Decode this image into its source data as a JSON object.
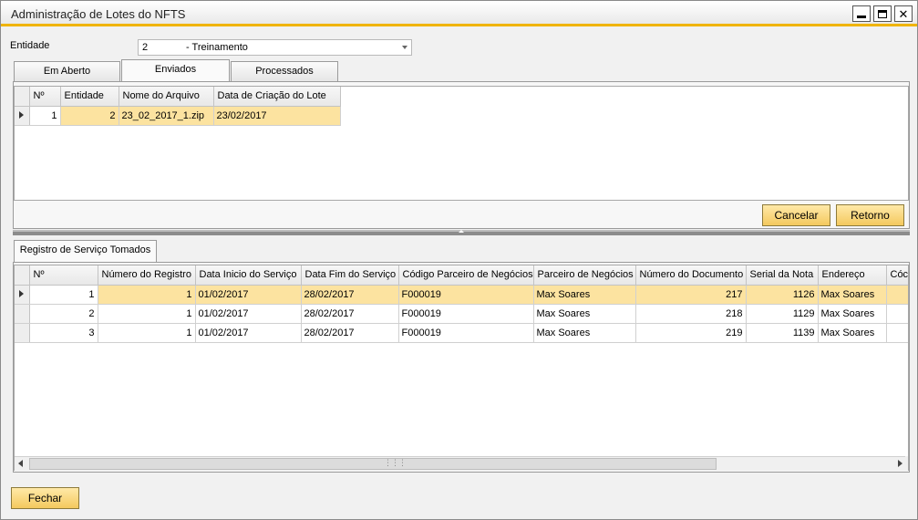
{
  "window": {
    "title": "Administração de Lotes do NFTS"
  },
  "entidade": {
    "label": "Entidade",
    "code": "2",
    "name": "- Treinamento"
  },
  "tabs": [
    {
      "label": "Em Aberto"
    },
    {
      "label": "Enviados"
    },
    {
      "label": "Processados"
    }
  ],
  "lotes_grid": {
    "columns": [
      "Nº",
      "Entidade",
      "Nome do Arquivo",
      "Data de Criação do Lote"
    ],
    "rows": [
      {
        "num": "1",
        "entidade": "2",
        "arquivo": "23_02_2017_1.zip",
        "data": "23/02/2017"
      }
    ]
  },
  "actions": {
    "cancelar": "Cancelar",
    "retorno": "Retorno"
  },
  "sub_tab": {
    "label": "Registro de Serviço Tomados"
  },
  "registros_grid": {
    "columns": [
      "Nº",
      "Número do Registro",
      "Data Inicio do Serviço",
      "Data Fim do Serviço",
      "Código Parceiro de Negócios",
      "Parceiro de Negócios",
      "Número do Documento",
      "Serial da Nota",
      "Endereço",
      "Cóc"
    ],
    "rows": [
      {
        "num": "1",
        "registro": "1",
        "inicio": "01/02/2017",
        "fim": "28/02/2017",
        "cod": "F000019",
        "parceiro": "Max Soares",
        "documento": "217",
        "serial": "1126",
        "endereco": "Max Soares"
      },
      {
        "num": "2",
        "registro": "1",
        "inicio": "01/02/2017",
        "fim": "28/02/2017",
        "cod": "F000019",
        "parceiro": "Max Soares",
        "documento": "218",
        "serial": "1129",
        "endereco": "Max Soares"
      },
      {
        "num": "3",
        "registro": "1",
        "inicio": "01/02/2017",
        "fim": "28/02/2017",
        "cod": "F000019",
        "parceiro": "Max Soares",
        "documento": "219",
        "serial": "1139",
        "endereco": "Max Soares"
      }
    ]
  },
  "footer": {
    "fechar": "Fechar"
  },
  "icons": {
    "minimize": "minimize-icon",
    "maximize": "maximize-icon",
    "close": "close-icon",
    "row_marker": "row-marker-icon"
  },
  "colors": {
    "accent": "#f0b400",
    "selected_row": "#fce3a0",
    "button": "#f4c95e"
  }
}
